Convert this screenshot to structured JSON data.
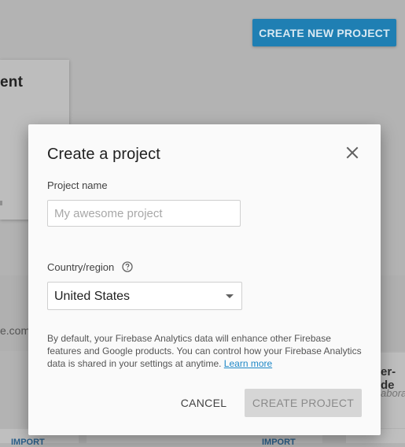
{
  "background": {
    "primary_button_label": "CREATE NEW PROJECT",
    "card_title_fragment": "ent",
    "domain_fragment": "e.com",
    "right_title_fragment": "er-de",
    "right_sub_fragment": "abora",
    "import_left": "IMPORT",
    "import_right": "IMPORT",
    "accent_color": "#1f7fb3"
  },
  "dialog": {
    "title": "Create a project",
    "close_icon": "close-icon",
    "project_name": {
      "label": "Project name",
      "placeholder": "My awesome project",
      "value": ""
    },
    "country": {
      "label": "Country/region",
      "help_icon": "help-circle-icon",
      "selected": "United States"
    },
    "disclaimer_text": "By default, your Firebase Analytics data will enhance other Firebase features and Google products. You can control how your Firebase Analytics data is shared in your settings at anytime. ",
    "learn_more_label": "Learn more",
    "learn_more_color": "#1e88c7",
    "cancel_label": "CANCEL",
    "create_label": "CREATE PROJECT"
  }
}
